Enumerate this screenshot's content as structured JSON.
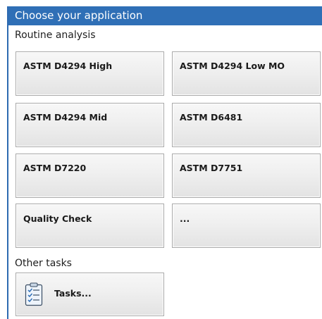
{
  "window": {
    "title": "Choose your application",
    "accent_color": "#2f6fb6"
  },
  "routine": {
    "heading": "Routine analysis",
    "tiles": [
      {
        "label": "ASTM D4294 High"
      },
      {
        "label": "ASTM D4294 Low MO"
      },
      {
        "label": "ASTM D4294 Mid"
      },
      {
        "label": "ASTM D6481"
      },
      {
        "label": "ASTM D7220"
      },
      {
        "label": "ASTM D7751"
      },
      {
        "label": "Quality Check"
      },
      {
        "label": "..."
      }
    ]
  },
  "other": {
    "heading": "Other tasks",
    "tasks_label": "Tasks...",
    "tasks_icon": "clipboard-checklist-icon"
  }
}
